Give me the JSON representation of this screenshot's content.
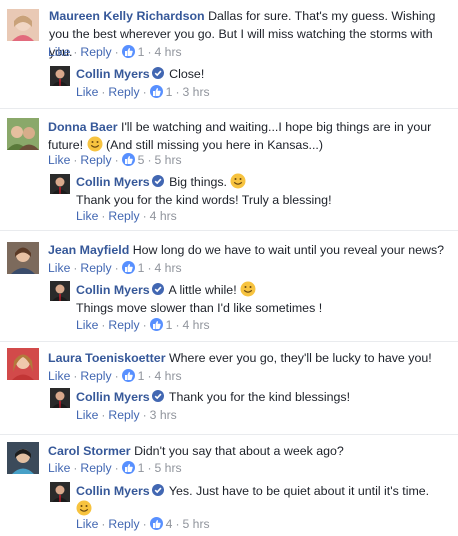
{
  "actions": {
    "like": "Like",
    "reply": "Reply",
    "dot": "·"
  },
  "threads": [
    {
      "comment": {
        "author": "Maureen Kelly Richardson",
        "text": "Dallas for sure. That's my guess. Wishing you the best wherever you go. But I will miss watching the storms with you.",
        "likes": "1",
        "time": "4 hrs"
      },
      "reply": {
        "author": "Collin Myers",
        "text": "Close!",
        "likes": "1",
        "time": "3 hrs"
      }
    },
    {
      "comment": {
        "author": "Donna Baer",
        "text": "I'll be watching and waiting...I hope big things are in your future!",
        "text2": "(And still missing you here in Kansas...)",
        "likes": "5",
        "time": "5 hrs"
      },
      "reply": {
        "author": "Collin Myers",
        "text": "Big things.",
        "text2": "Thank you for the kind words! Truly a blessing!",
        "likes": "",
        "time": "4 hrs"
      }
    },
    {
      "comment": {
        "author": "Jean Mayfield",
        "text": "How long do we have to wait until you reveal your news?",
        "likes": "1",
        "time": "4 hrs"
      },
      "reply": {
        "author": "Collin Myers",
        "text": "A little while!",
        "text2": "Things move slower than I'd like sometimes !",
        "likes": "1",
        "time": "4 hrs"
      }
    },
    {
      "comment": {
        "author": "Laura Toeniskoetter",
        "text": "Where ever you go, they'll be lucky to have you!",
        "likes": "1",
        "time": "4 hrs"
      },
      "reply": {
        "author": "Collin Myers",
        "text": "Thank you for the kind blessings!",
        "likes": "",
        "time": "3 hrs"
      }
    },
    {
      "comment": {
        "author": "Carol Stormer",
        "text": "Didn't you say that about a week ago?",
        "likes": "1",
        "time": "5 hrs"
      },
      "reply": {
        "author": "Collin Myers",
        "text": "Yes. Just have to be quiet about it until it's time.",
        "likes": "4",
        "time": "5 hrs"
      }
    }
  ],
  "colors": {
    "link": "#365899",
    "action": "#4267b2",
    "meta": "#90949c",
    "like_badge": "#5890ff",
    "verified": "#4267b2"
  }
}
